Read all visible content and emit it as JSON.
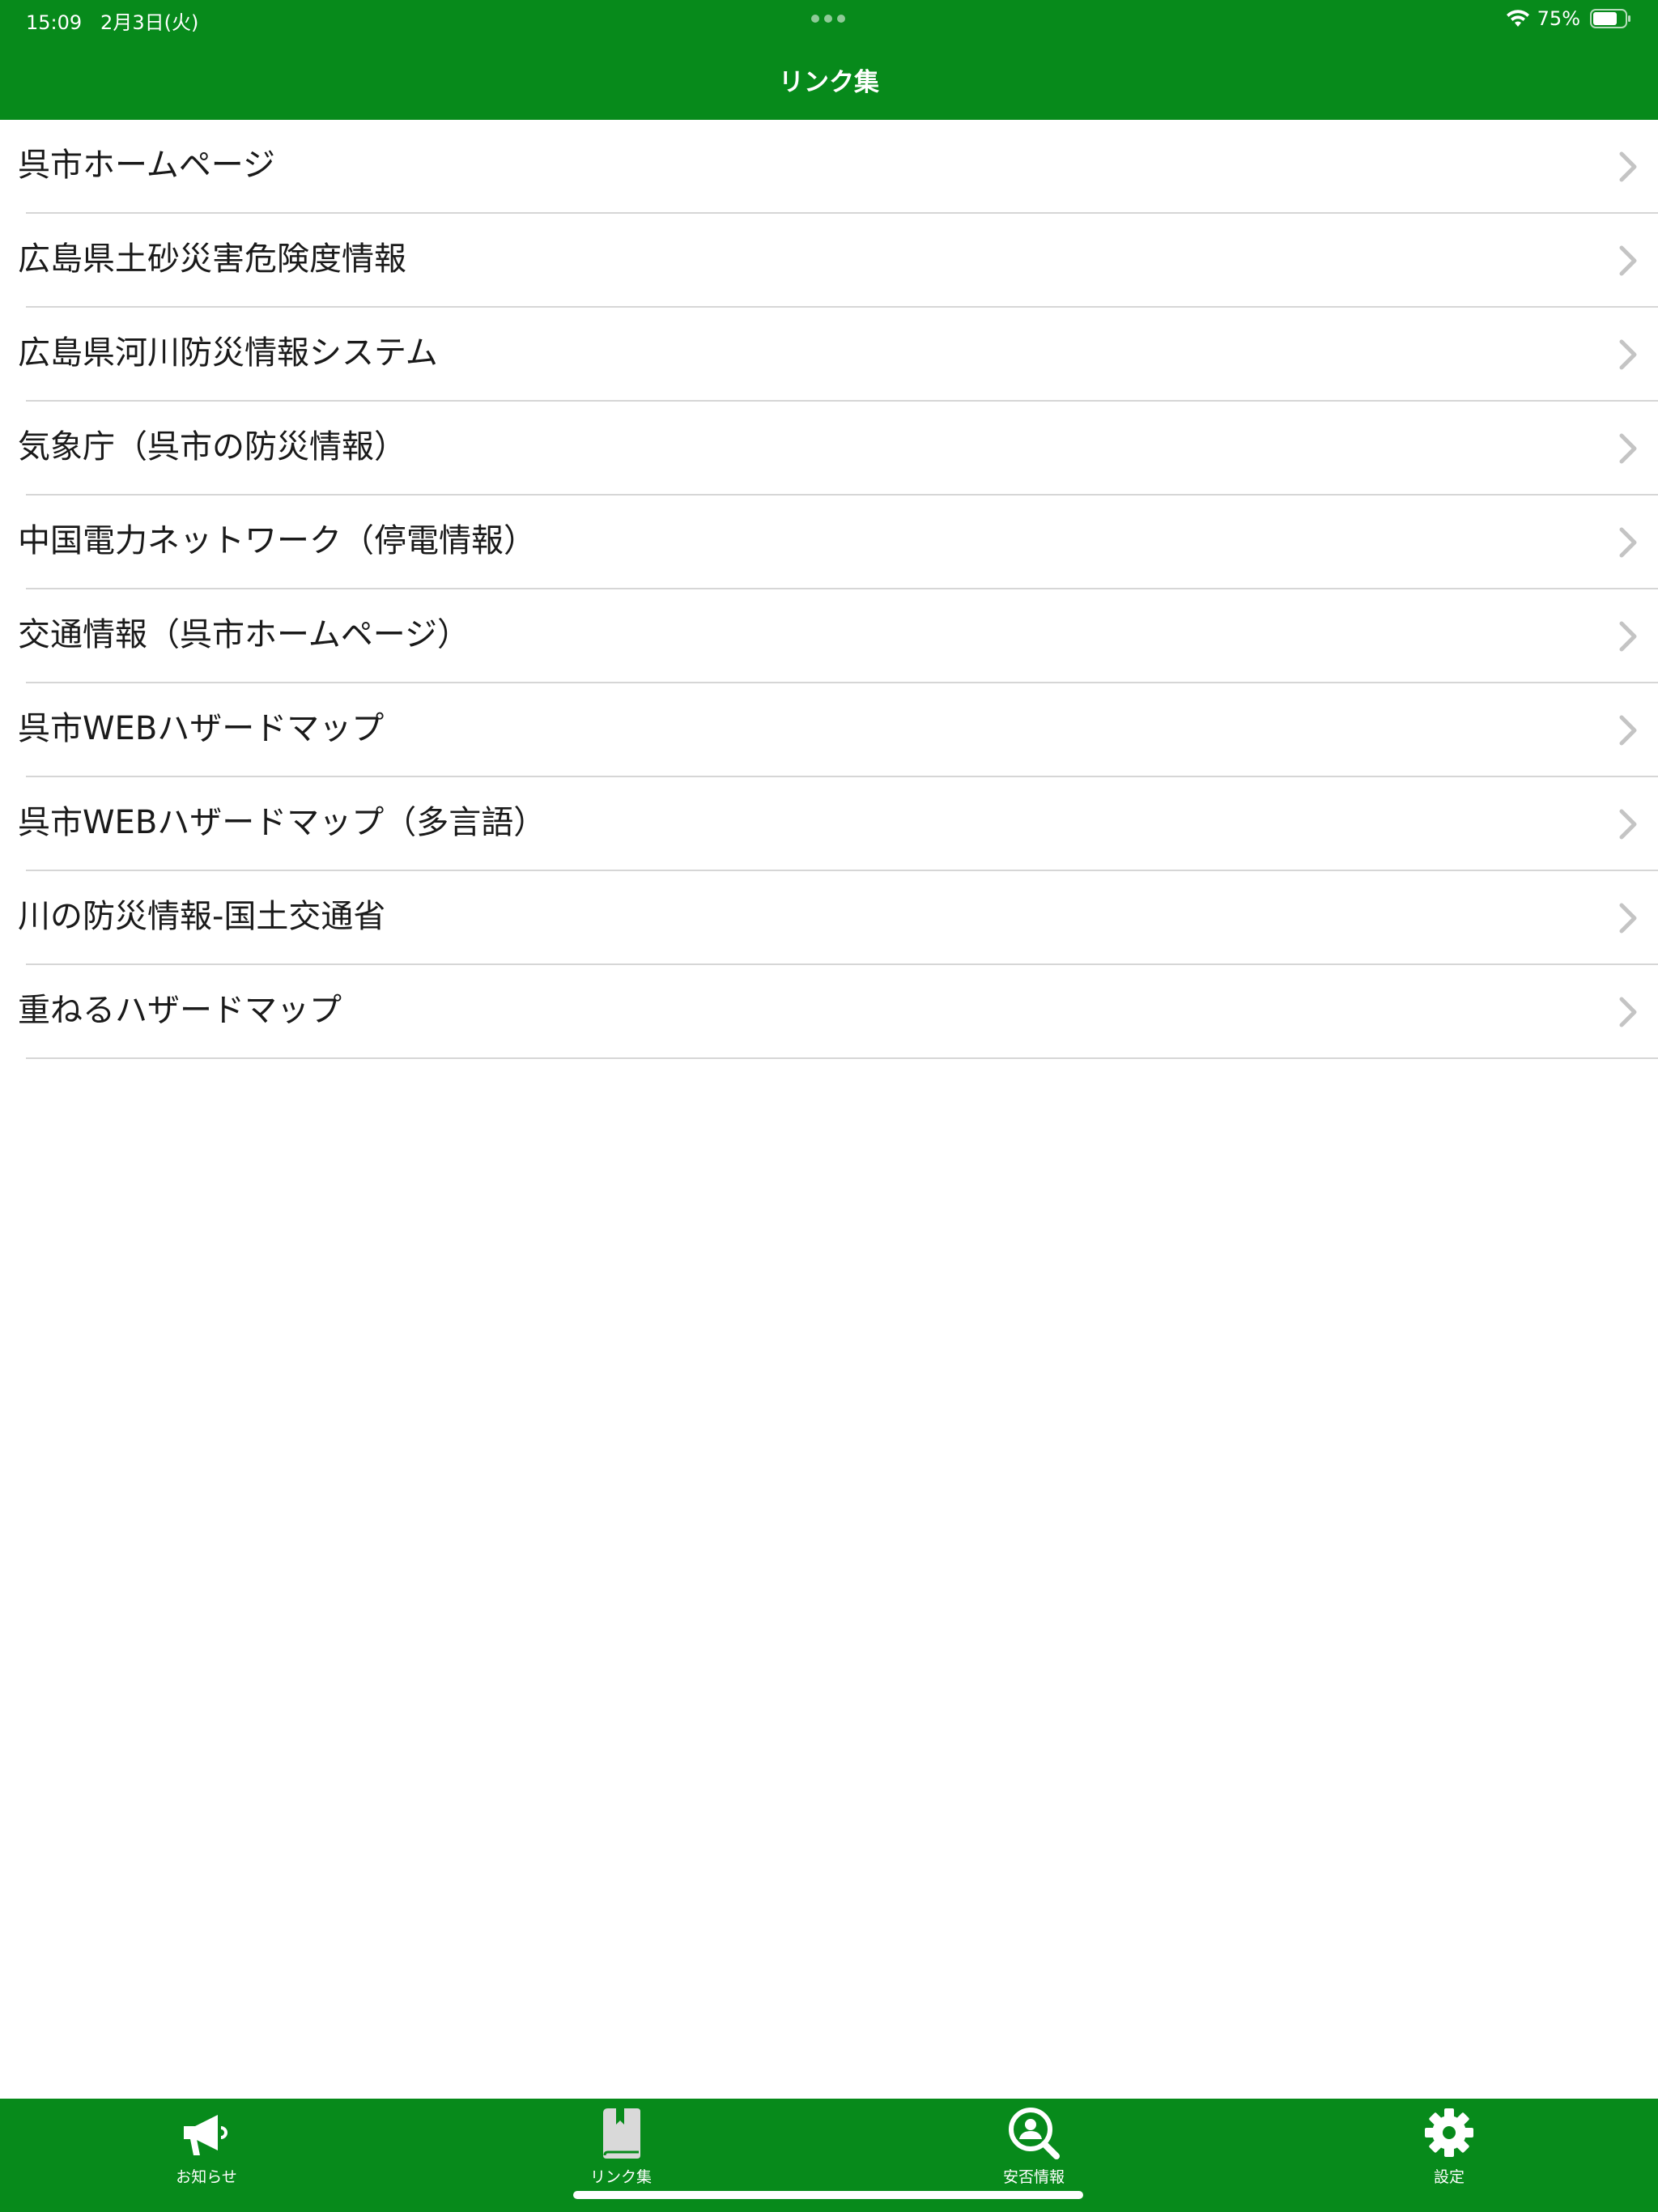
{
  "status_bar": {
    "time": "15:09   2月3日(火)",
    "battery_percent": "75%",
    "battery_level": 0.75
  },
  "nav": {
    "title": "リンク集"
  },
  "links": [
    {
      "label": "呉市ホームページ"
    },
    {
      "label": "広島県土砂災害危険度情報"
    },
    {
      "label": "広島県河川防災情報システム"
    },
    {
      "label": "気象庁（呉市の防災情報）"
    },
    {
      "label": "中国電力ネットワーク（停電情報）"
    },
    {
      "label": "交通情報（呉市ホームページ）"
    },
    {
      "label": "呉市WEBハザードマップ"
    },
    {
      "label": "呉市WEBハザードマップ（多言語）"
    },
    {
      "label": "川の防災情報-国土交通省"
    },
    {
      "label": "重ねるハザードマップ"
    }
  ],
  "tabs": [
    {
      "label": "お知らせ",
      "icon": "megaphone-icon"
    },
    {
      "label": "リンク集",
      "icon": "bookmark-book-icon",
      "selected": true
    },
    {
      "label": "安否情報",
      "icon": "person-search-icon"
    },
    {
      "label": "設定",
      "icon": "gear-icon"
    }
  ],
  "colors": {
    "brand_green": "#078a1b",
    "chevron_gray": "#c4c4c4",
    "divider": "#d6d6d6",
    "tab_selected_icon": "#d9d9d9"
  }
}
